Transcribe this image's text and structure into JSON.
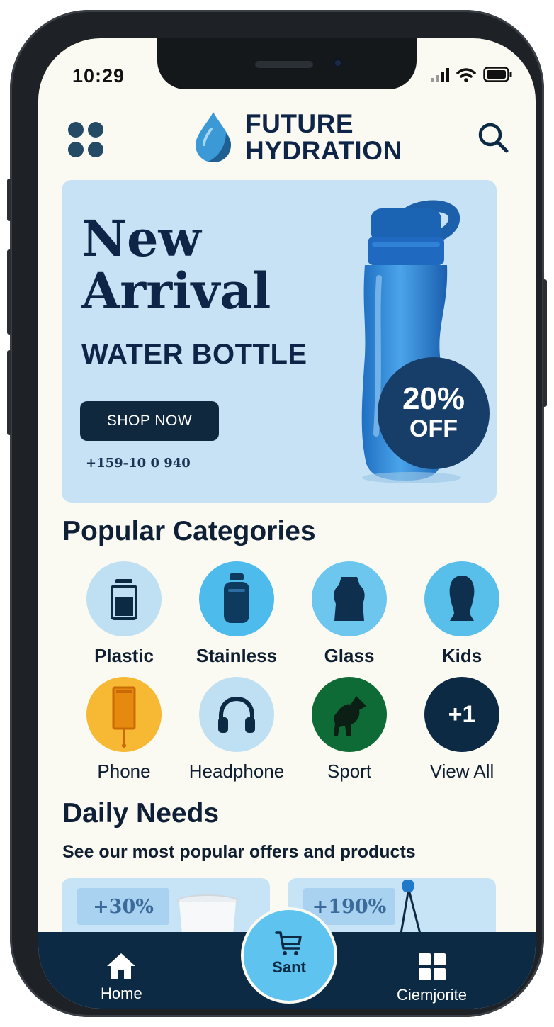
{
  "status_bar": {
    "time": "10:29"
  },
  "header": {
    "brand_line1": "FUTURE",
    "brand_line2": "HYDRATION"
  },
  "hero": {
    "title_line1": "New",
    "title_line2": "Arrival",
    "subtitle": "WATER BOTTLE",
    "button_label": "SHOP NOW",
    "phone": "+159-10 0 940",
    "discount_pct": "20%",
    "discount_off": "OFF"
  },
  "categories": {
    "title": "Popular Categories",
    "items": [
      {
        "label": "Plastic",
        "icon": "plastic-bottle-icon",
        "color": "#bfe0f3"
      },
      {
        "label": "Stainless",
        "icon": "stainless-bottle-icon",
        "color": "#4dbbec"
      },
      {
        "label": "Glass",
        "icon": "glass-bottle-icon",
        "color": "#6cc6ee"
      },
      {
        "label": "Kids",
        "icon": "kids-bottle-icon",
        "color": "#58bfea"
      },
      {
        "label": "Phone",
        "icon": "phone-icon",
        "color": "#f7b933"
      },
      {
        "label": "Headphone",
        "icon": "headphone-icon",
        "color": "#bfe0f3"
      },
      {
        "label": "Sport",
        "icon": "sport-icon",
        "color": "#0f6b36"
      },
      {
        "label": "View All",
        "icon": "view-all-icon",
        "badge": "+1",
        "color": "#0d2a44"
      }
    ]
  },
  "daily": {
    "title": "Daily Needs",
    "subtitle": "See our most popular offers and products",
    "cards": [
      {
        "badge": "+30%"
      },
      {
        "badge": "+190%"
      }
    ]
  },
  "nav": {
    "home": "Home",
    "cart": "Sant",
    "favorite": "Ciemjorite"
  }
}
